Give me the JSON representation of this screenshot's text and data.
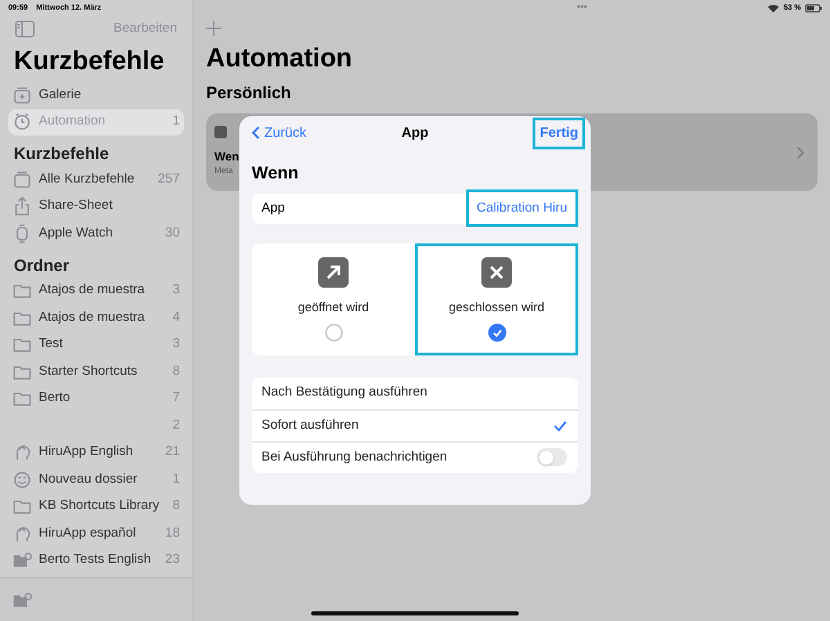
{
  "status_bar": {
    "time": "09:59",
    "date": "Mittwoch 12. März",
    "dots": "•••",
    "battery": "53 %"
  },
  "sidebar": {
    "edit": "Bearbeiten",
    "title": "Kurzbefehle",
    "top_items": [
      {
        "label": "Galerie",
        "kind": "gallery",
        "selected": false
      },
      {
        "label": "Automation",
        "count": "1",
        "kind": "clock",
        "selected": true
      }
    ],
    "sections": [
      {
        "title": "Kurzbefehle",
        "items": [
          {
            "label": "Alle Kurzbefehle",
            "count": "257",
            "kind": "stack"
          },
          {
            "label": "Share-Sheet",
            "kind": "share"
          },
          {
            "label": "Apple Watch",
            "count": "30",
            "kind": "watch"
          }
        ]
      },
      {
        "title": "Ordner",
        "items": [
          {
            "label": "Atajos de muestra",
            "count": "3",
            "kind": "folder"
          },
          {
            "label": "Atajos de muestra",
            "count": "4",
            "kind": "folder"
          },
          {
            "label": "Test",
            "count": "3",
            "kind": "folder"
          },
          {
            "label": "Starter Shortcuts",
            "count": "8",
            "kind": "folder"
          },
          {
            "label": "Berto",
            "count": "7",
            "kind": "folder"
          },
          {
            "count": "2",
            "kind": "none"
          },
          {
            "label": "HiruApp English",
            "count": "21",
            "kind": "brain"
          },
          {
            "label": "Nouveau dossier",
            "count": "1",
            "kind": "emoji"
          },
          {
            "label": "KB Shortcuts Library",
            "count": "8",
            "kind": "folder"
          },
          {
            "label": "HiruApp español",
            "count": "18",
            "kind": "brain"
          },
          {
            "label": "Berto Tests English",
            "count": "23",
            "kind": "folder-gear"
          }
        ]
      }
    ]
  },
  "main": {
    "title": "Automation",
    "section": "Persönlich",
    "card": {
      "title": "Wen",
      "subtitle": "Meta"
    }
  },
  "dialog": {
    "back": "Zurück",
    "title": "App",
    "done": "Fertig",
    "done_highlighted": true,
    "heading": "Wenn",
    "app_row": {
      "label": "App",
      "value": "Calibration Hiru",
      "highlighted": true
    },
    "options": [
      {
        "label": "geöffnet wird",
        "kind": "arrow",
        "selected": false,
        "highlighted": false
      },
      {
        "label": "geschlossen wird",
        "kind": "cross",
        "selected": true,
        "highlighted": true
      }
    ],
    "run_modes": [
      {
        "label": "Nach Bestätigung ausführen",
        "kind": "choice",
        "selected": false
      },
      {
        "label": "Sofort ausführen",
        "kind": "choice",
        "selected": true
      },
      {
        "label": "Bei Ausführung benachrichtigen",
        "kind": "toggle",
        "on": false
      }
    ]
  }
}
